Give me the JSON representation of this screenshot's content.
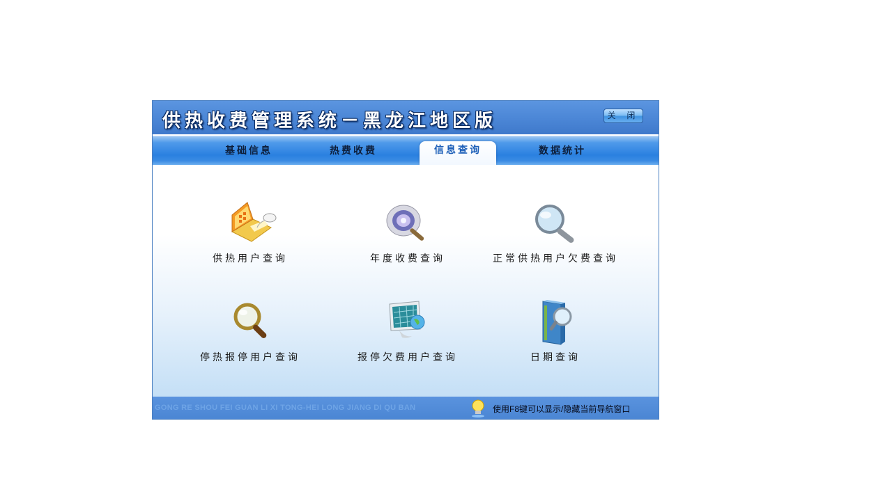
{
  "window": {
    "title": "供热收费管理系统－黑龙江地区版",
    "close_label": "关 闭"
  },
  "tabs": [
    {
      "label": "基础信息",
      "active": false
    },
    {
      "label": "热费收费",
      "active": false
    },
    {
      "label": "信息查询",
      "active": true
    },
    {
      "label": "数据统计",
      "active": false
    }
  ],
  "items": [
    {
      "label": "供热用户查询",
      "icon": "laptop-icon"
    },
    {
      "label": "年度收费查询",
      "icon": "cd-magnifier-icon"
    },
    {
      "label": "正常供热用户欠费查询",
      "icon": "magnifier-icon"
    },
    {
      "label": "停热报停用户查询",
      "icon": "gold-magnifier-icon"
    },
    {
      "label": "报停欠费用户查询",
      "icon": "monitor-globe-icon"
    },
    {
      "label": "日期查询",
      "icon": "book-magnifier-icon"
    }
  ],
  "status": {
    "pinyin": "GONG RE SHOU FEI GUAN LI XI TONG-HEI LONG JIANG DI QU BAN",
    "hint": "使用F8键可以显示/隐藏当前导航窗口",
    "hint_icon": "lightbulb-icon"
  },
  "colors": {
    "titlebar": "#4b86d6",
    "tabbar": "#2a80e0",
    "active_tab_text": "#1d5fb8",
    "statusbar": "#4a85d3"
  }
}
